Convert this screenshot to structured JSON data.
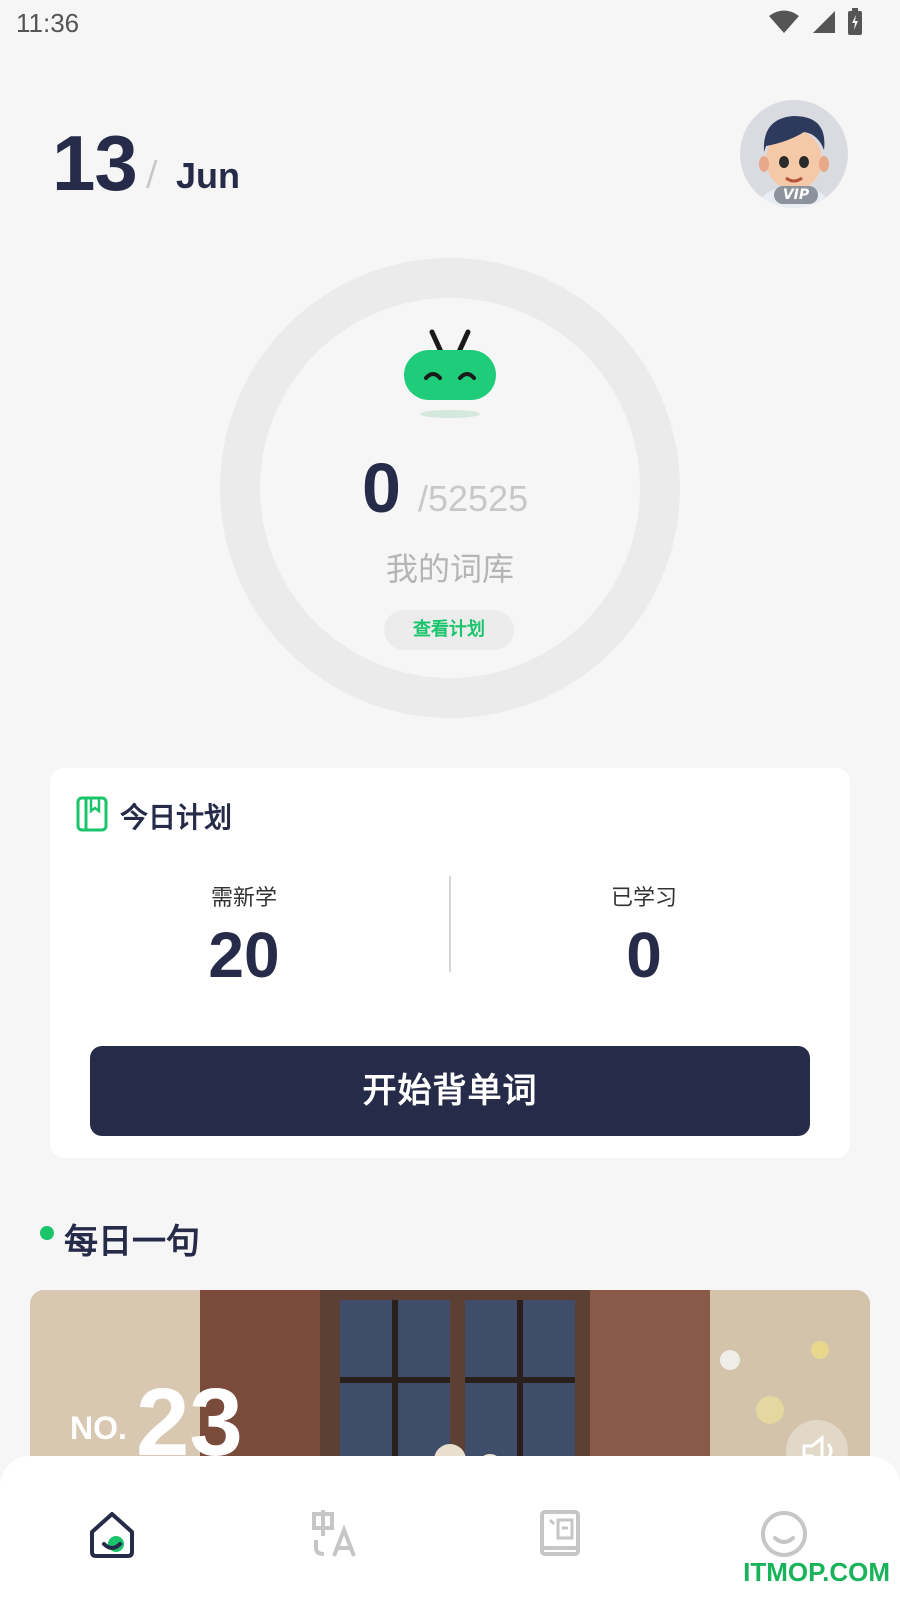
{
  "status_bar": {
    "time": "11:36"
  },
  "date": {
    "day": "13",
    "separator": "/",
    "month": "Jun"
  },
  "avatar": {
    "badge": "VIP"
  },
  "progress": {
    "learned": "0",
    "total": "/52525",
    "label": "我的词库",
    "view_plan_label": "查看计划"
  },
  "plan": {
    "title": "今日计划",
    "new_label": "需新学",
    "new_value": "20",
    "learned_label": "已学习",
    "learned_value": "0",
    "start_label": "开始背单词"
  },
  "daily": {
    "title": "每日一句",
    "no_prefix": "NO.",
    "no_number": "23"
  },
  "nav": {
    "items": [
      "home-icon",
      "translate-icon",
      "dictionary-icon",
      "profile-icon"
    ]
  },
  "watermark": "ITMOP.COM",
  "colors": {
    "accent": "#19c46b",
    "primary": "#252b48",
    "background": "#f6f6f6"
  }
}
